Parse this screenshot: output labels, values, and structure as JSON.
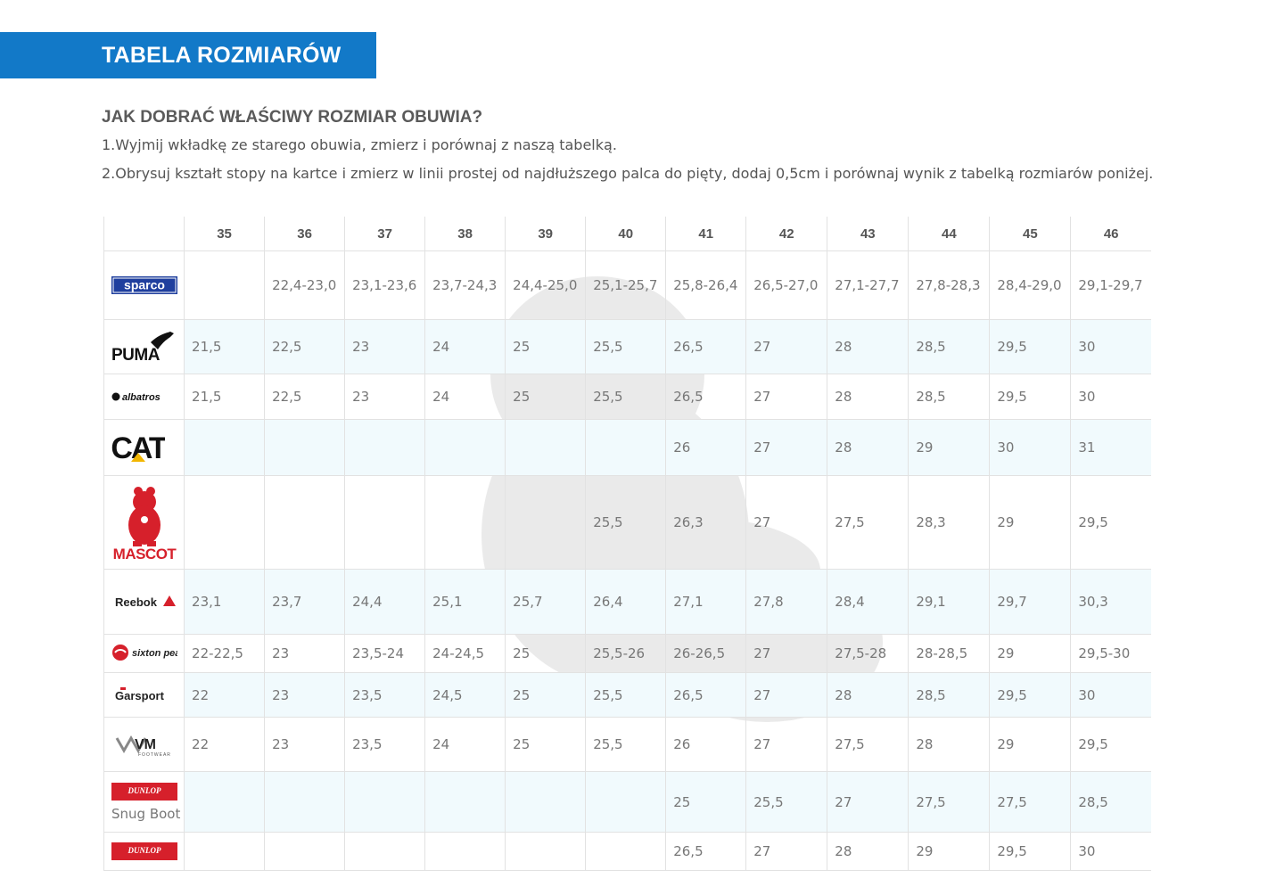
{
  "banner": {
    "title": "TABELA ROZMIARÓW"
  },
  "intro": {
    "title": "JAK DOBRAĆ WŁAŚCIWY ROZMIAR OBUWIA?",
    "step1": "1.Wyjmij wkładkę ze starego obuwia, zmierz i porównaj z naszą tabelką.",
    "step2": "2.Obrysuj kształt stopy na kartce i zmierz w linii prostej od najdłuższego palca do pięty, dodaj 0,5cm i porównaj wynik z tabelką rozmiarów poniżej."
  },
  "table": {
    "sizes": [
      "35",
      "36",
      "37",
      "38",
      "39",
      "40",
      "41",
      "42",
      "43",
      "44",
      "45",
      "46"
    ],
    "rows": [
      {
        "brand": "sparco",
        "icon": "sparco-logo-icon",
        "values": [
          "",
          "22,4-23,0",
          "23,1-23,6",
          "23,7-24,3",
          "24,4-25,0",
          "25,1-25,7",
          "25,8-26,4",
          "26,5-27,0",
          "27,1-27,7",
          "27,8-28,3",
          "28,4-29,0",
          "29,1-29,7"
        ]
      },
      {
        "brand": "PUMA",
        "icon": "puma-logo-icon",
        "values": [
          "21,5",
          "22,5",
          "23",
          "24",
          "25",
          "25,5",
          "26,5",
          "27",
          "28",
          "28,5",
          "29,5",
          "30"
        ]
      },
      {
        "brand": "albatros",
        "icon": "albatros-logo-icon",
        "values": [
          "21,5",
          "22,5",
          "23",
          "24",
          "25",
          "25,5",
          "26,5",
          "27",
          "28",
          "28,5",
          "29,5",
          "30"
        ]
      },
      {
        "brand": "CAT",
        "icon": "cat-logo-icon",
        "values": [
          "",
          "",
          "",
          "",
          "",
          "",
          "26",
          "27",
          "28",
          "29",
          "30",
          "31"
        ]
      },
      {
        "brand": "MASCOT",
        "icon": "mascot-logo-icon",
        "values": [
          "",
          "",
          "",
          "",
          "",
          "25,5",
          "26,3",
          "27",
          "27,5",
          "28,3",
          "29",
          "29,5"
        ]
      },
      {
        "brand": "Reebok",
        "icon": "reebok-logo-icon",
        "values": [
          "23,1",
          "23,7",
          "24,4",
          "25,1",
          "25,7",
          "26,4",
          "27,1",
          "27,8",
          "28,4",
          "29,1",
          "29,7",
          "30,3"
        ]
      },
      {
        "brand": "sixton peak",
        "icon": "sixton-logo-icon",
        "values": [
          "22-22,5",
          "23",
          "23,5-24",
          "24-24,5",
          "25",
          "25,5-26",
          "26-26,5",
          "27",
          "27,5-28",
          "28-28,5",
          "29",
          "29,5-30"
        ]
      },
      {
        "brand": "Garsport",
        "icon": "garsport-logo-icon",
        "values": [
          "22",
          "23",
          "23,5",
          "24,5",
          "25",
          "25,5",
          "26,5",
          "27",
          "28",
          "28,5",
          "29,5",
          "30"
        ]
      },
      {
        "brand": "VM FOOTWEAR",
        "icon": "vm-logo-icon",
        "values": [
          "22",
          "23",
          "23,5",
          "24",
          "25",
          "25,5",
          "26",
          "27",
          "27,5",
          "28",
          "29",
          "29,5"
        ]
      },
      {
        "brand": "DUNLOP",
        "icon": "dunlop-logo-icon",
        "sub": "Snug Boot",
        "values": [
          "",
          "",
          "",
          "",
          "",
          "",
          "25",
          "25,5",
          "27",
          "27,5",
          "27,5",
          "28,5"
        ]
      },
      {
        "brand": "DUNLOP",
        "icon": "dunlop-logo-icon",
        "values": [
          "",
          "",
          "",
          "",
          "",
          "",
          "26,5",
          "27",
          "28",
          "29",
          "29,5",
          "30"
        ]
      }
    ]
  },
  "colors": {
    "banner": "#1279c8",
    "row_shade": "#f1fafd",
    "grid": "#e2e2e2"
  }
}
